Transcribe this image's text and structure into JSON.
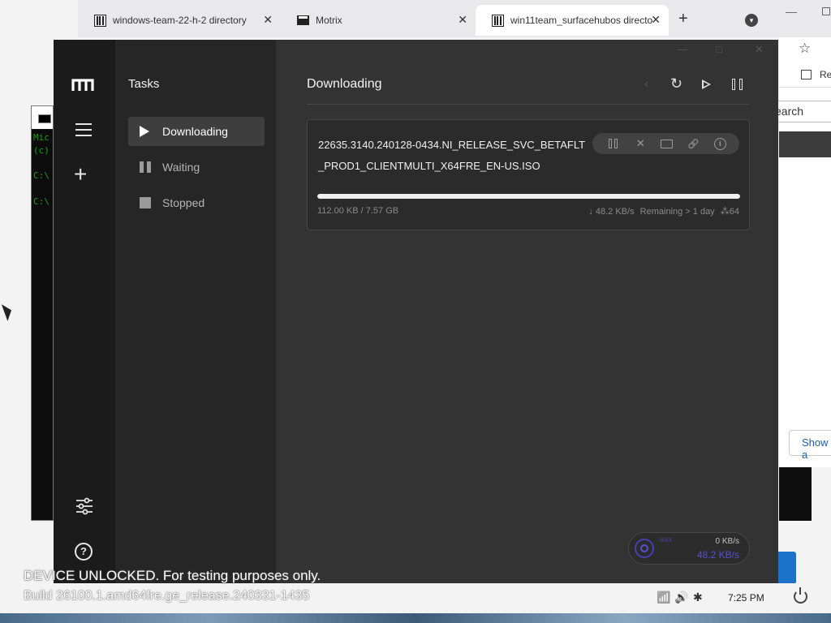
{
  "browser": {
    "tabs": [
      {
        "title": "windows-team-22-h-2 directory",
        "close": "✕"
      },
      {
        "title": "Motrix",
        "close": "✕"
      },
      {
        "title": "win11team_surfacehubos directo",
        "close": "✕"
      }
    ],
    "new_tab": "+",
    "bookmark_label": "Re",
    "search_placeholder": "earch",
    "show_button": "Show a"
  },
  "console": {
    "lines": [
      "Mic",
      "(c)",
      "C:\\",
      "C:\\"
    ]
  },
  "motrix": {
    "window_controls": {
      "minimize": "—",
      "maximize": "□",
      "close": "✕"
    },
    "nav": {
      "menu_icon": "menu-icon",
      "add_icon": "plus-icon",
      "settings_icon": "sliders-icon",
      "help": "?"
    },
    "sidebar": {
      "title": "Tasks",
      "items": [
        {
          "label": "Downloading",
          "icon": "play-icon",
          "active": true
        },
        {
          "label": "Waiting",
          "icon": "pause-icon",
          "active": false
        },
        {
          "label": "Stopped",
          "icon": "stop-icon",
          "active": false
        }
      ]
    },
    "main": {
      "title": "Downloading",
      "toolbar": {
        "back": "‹",
        "refresh": "↻"
      }
    },
    "task": {
      "name": "22635.3140.240128-0434.NI_RELEASE_SVC_BETAFLT_PROD1_CLIENTMULTI_X64FRE_EN-US.ISO",
      "size": "112.00 KB / 7.57 GB",
      "speed": "↓ 48.2 KB/s",
      "remaining": "Remaining > 1 day",
      "connections": "⁂64",
      "progress_percent": 100,
      "actions": {
        "delete": "✕",
        "link": "🔗",
        "info": "i"
      }
    },
    "speedometer": {
      "max_label": "MAX",
      "upload": "0 KB/s",
      "download": "48.2 KB/s"
    }
  },
  "overlay": {
    "line1": "DEVICE UNLOCKED. For testing purposes only.",
    "line2": "Build 26100.1.amd64fre.ge_release.240331-1435"
  },
  "taskbar": {
    "wifi": "📶",
    "volume": "🔊",
    "accessibility": "✱",
    "time": "7:25 PM"
  }
}
